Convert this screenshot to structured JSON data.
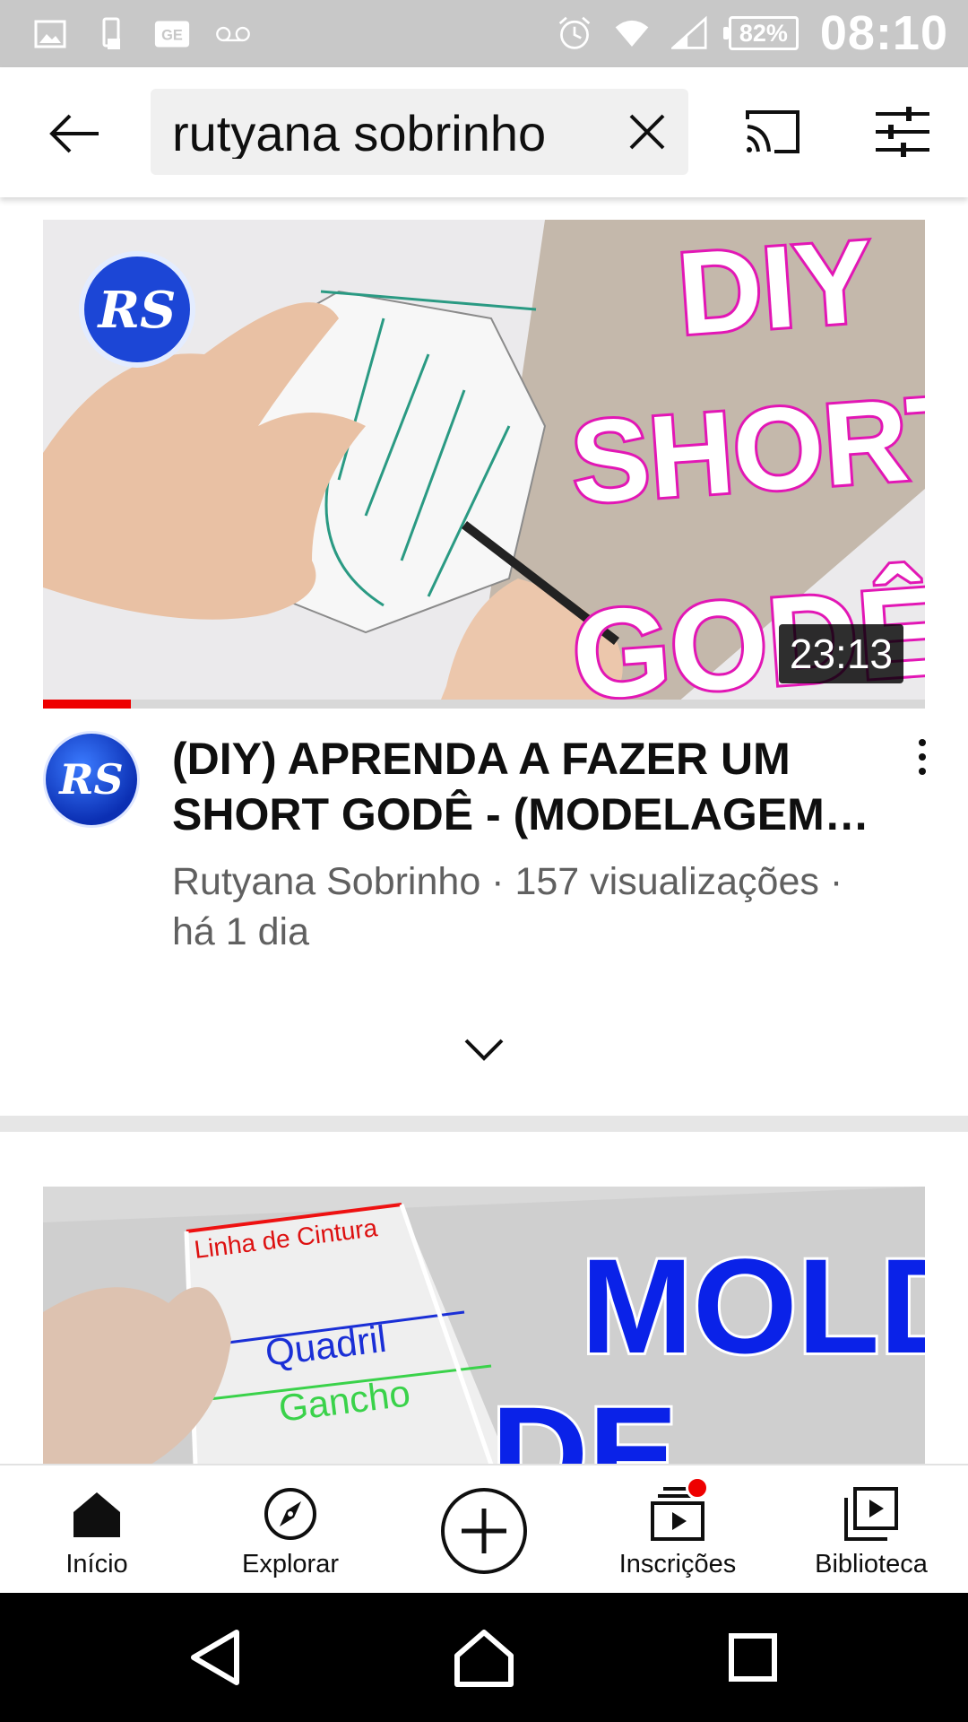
{
  "status_bar": {
    "battery": "82%",
    "time": "08:10",
    "icons": [
      "image-icon",
      "phone-icon",
      "ge-icon",
      "voicemail-icon",
      "alarm-icon",
      "wifi-icon",
      "signal-icon"
    ]
  },
  "header": {
    "query": "rutyana sobrinho",
    "icons": [
      "back-arrow-icon",
      "clear-icon",
      "cast-icon",
      "filter-icon"
    ]
  },
  "video": {
    "thumb_badge": "RS",
    "thumb_caption": [
      "DIY",
      "SHORT",
      "GODÊ"
    ],
    "duration": "23:13",
    "watched_fraction": 0.1,
    "avatar_text": "RS",
    "title": "(DIY) APRENDA A FAZER UM SHORT GODÊ - (MODELAGEM…",
    "title_line1": "(DIY) APRENDA A FAZER UM",
    "title_line2": "SHORT GODÊ - (MODELAGEM…",
    "meta_line1": "Rutyana Sobrinho · 157 visualizações ·",
    "meta_line2": "há 1 dia"
  },
  "video2": {
    "labels": [
      "Linha de Cintura",
      "Quadril",
      "Gancho"
    ],
    "caption": [
      "MOLDE",
      "DE"
    ]
  },
  "bottom_nav": [
    {
      "label": "Início",
      "icon": "home-icon",
      "active": true
    },
    {
      "label": "Explorar",
      "icon": "compass-icon"
    },
    {
      "label": "",
      "icon": "create-icon"
    },
    {
      "label": "Inscrições",
      "icon": "subscriptions-icon",
      "badge": true
    },
    {
      "label": "Biblioteca",
      "icon": "library-icon"
    }
  ],
  "colors": {
    "accent_red": "#ee0000",
    "status_bar": "#c8c8c8",
    "text_secondary": "#606060"
  }
}
